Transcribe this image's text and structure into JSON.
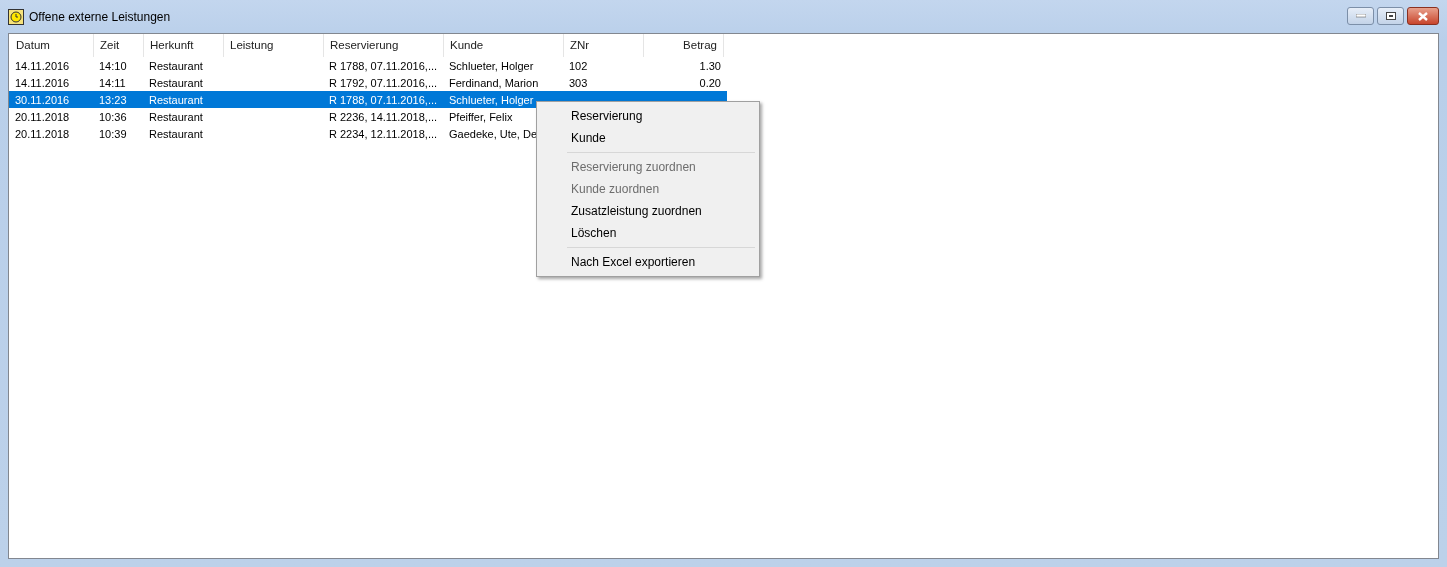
{
  "window": {
    "title": "Offene externe Leistungen"
  },
  "table": {
    "columns": [
      {
        "label": "Datum"
      },
      {
        "label": "Zeit"
      },
      {
        "label": "Herkunft"
      },
      {
        "label": "Leistung"
      },
      {
        "label": "Reservierung"
      },
      {
        "label": "Kunde"
      },
      {
        "label": "ZNr"
      },
      {
        "label": "Betrag"
      }
    ],
    "rows": [
      {
        "selected": false,
        "cells": [
          "14.11.2016",
          "14:10",
          "Restaurant",
          "",
          "R 1788, 07.11.2016,...",
          "Schlueter, Holger",
          "102",
          "1.30"
        ]
      },
      {
        "selected": false,
        "cells": [
          "14.11.2016",
          "14:11",
          "Restaurant",
          "",
          "R 1792, 07.11.2016,...",
          "Ferdinand, Marion",
          "303",
          "0.20"
        ]
      },
      {
        "selected": true,
        "cells": [
          "30.11.2016",
          "13:23",
          "Restaurant",
          "",
          "R 1788, 07.11.2016,...",
          "Schlueter, Holger",
          "",
          ""
        ]
      },
      {
        "selected": false,
        "cells": [
          "20.11.2018",
          "10:36",
          "Restaurant",
          "",
          "R 2236, 14.11.2018,...",
          "Pfeiffer, Felix",
          "",
          ""
        ]
      },
      {
        "selected": false,
        "cells": [
          "20.11.2018",
          "10:39",
          "Restaurant",
          "",
          "R 2234, 12.11.2018,...",
          "Gaedeke, Ute, De",
          "",
          ""
        ]
      }
    ]
  },
  "context_menu": {
    "items": [
      {
        "kind": "item",
        "label": "Reservierung",
        "disabled": false
      },
      {
        "kind": "item",
        "label": "Kunde",
        "disabled": false
      },
      {
        "kind": "separator"
      },
      {
        "kind": "item",
        "label": "Reservierung zuordnen",
        "disabled": true
      },
      {
        "kind": "item",
        "label": "Kunde zuordnen",
        "disabled": true
      },
      {
        "kind": "item",
        "label": "Zusatzleistung zuordnen",
        "disabled": false
      },
      {
        "kind": "item",
        "label": "Löschen",
        "disabled": false
      },
      {
        "kind": "separator"
      },
      {
        "kind": "item",
        "label": "Nach Excel exportieren",
        "disabled": false
      }
    ]
  }
}
